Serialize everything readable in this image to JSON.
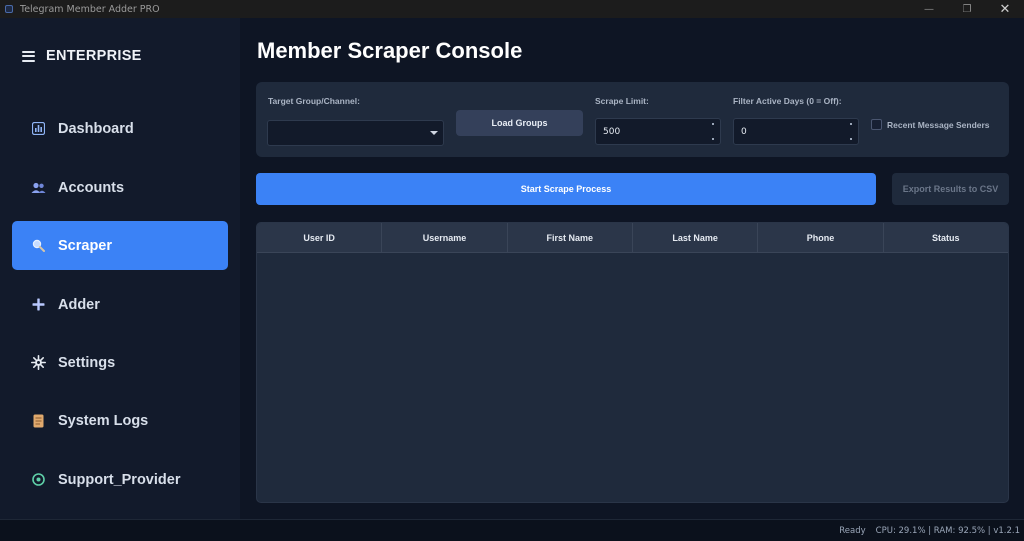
{
  "window": {
    "title": "Telegram Member Adder PRO",
    "controls": {
      "minimize": "—",
      "restore": "❐",
      "close": "✕"
    }
  },
  "sidebar": {
    "brand": "ENTERPRISE",
    "items": [
      {
        "label": "Dashboard",
        "icon": "bar-chart-icon",
        "color": "#8fb4f5"
      },
      {
        "label": "Accounts",
        "icon": "users-icon",
        "color": "#8aa2f0"
      },
      {
        "label": "Scraper",
        "icon": "magnifier-icon",
        "color": "#c7dcff",
        "active": true
      },
      {
        "label": "Adder",
        "icon": "plus-icon",
        "color": "#b9c9ff"
      },
      {
        "label": "Settings",
        "icon": "gear-icon",
        "color": "#e6ebf2"
      },
      {
        "label": "System Logs",
        "icon": "scroll-icon",
        "color": "#e0a96d"
      },
      {
        "label": "Support_Provider",
        "icon": "support-icon",
        "color": "#5fd0a8"
      }
    ]
  },
  "main": {
    "title": "Member Scraper Console",
    "controls": {
      "target_label": "Target Group/Channel:",
      "target_value": "",
      "load_button": "Load Groups",
      "limit_label": "Scrape Limit:",
      "limit_value": "500",
      "filter_label": "Filter Active Days (0 = Off):",
      "filter_value": "0",
      "recent_label": "Recent Message Senders"
    },
    "start_button": "Start Scrape Process",
    "export_button": "Export Results to CSV",
    "table": {
      "columns": [
        "User ID",
        "Username",
        "First Name",
        "Last Name",
        "Phone",
        "Status"
      ],
      "rows": []
    }
  },
  "statusbar": {
    "state": "Ready",
    "stats": "CPU: 29.1% | RAM: 92.5% | v1.2.1"
  },
  "colors": {
    "accent": "#3b82f6",
    "sidebar_bg": "#121a2b",
    "main_bg": "#0e1524",
    "panel_bg": "#1f2a3c"
  }
}
